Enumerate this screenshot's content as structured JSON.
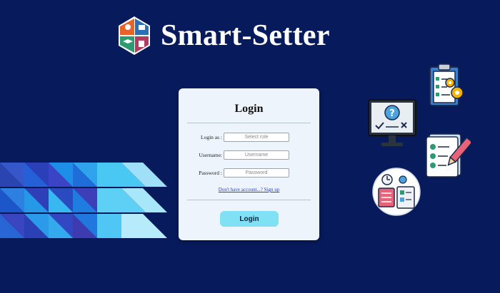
{
  "brand": {
    "title": "Smart-Setter",
    "logo_icon": "smart-setter-logo-icon"
  },
  "login": {
    "title": "Login",
    "login_as_label": "Login as :",
    "login_as_placeholder": "Select role",
    "username_label": "Username:",
    "username_placeholder": "Username",
    "password_label": "Password :",
    "password_placeholder": "Password",
    "signup_link": "Don't have account...? Sign up",
    "button_label": "Login"
  },
  "colors": {
    "background": "#071a5c",
    "card": "#eef4fb",
    "button": "#7fe1f3",
    "link": "#2a3ec9"
  },
  "icons": [
    "clipboard-gears-icon",
    "monitor-question-icon",
    "checklist-pencil-icon",
    "calendar-documents-icon",
    "triangle-mosaic-decoration"
  ]
}
